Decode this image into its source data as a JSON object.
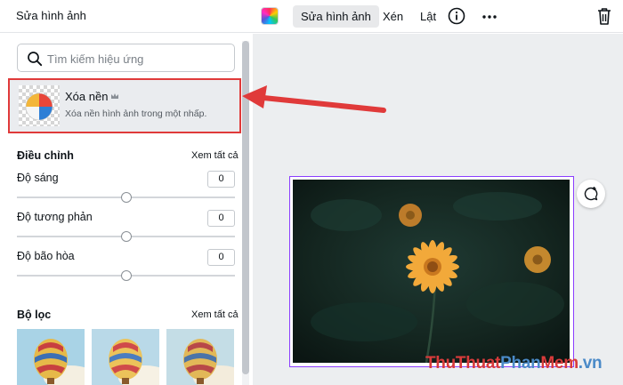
{
  "header": {
    "panel_title": "Sửa hình ảnh",
    "toolbar": [
      {
        "label": "Sửa hình ảnh",
        "active": true
      },
      {
        "label": "Xén",
        "active": false
      },
      {
        "label": "Lật",
        "active": false
      }
    ],
    "icons": [
      "color-picker-icon",
      "info-icon",
      "more-icon",
      "trash-icon"
    ]
  },
  "search": {
    "placeholder": "Tìm kiếm hiệu ứng",
    "value": ""
  },
  "featured_effect": {
    "name": "Xóa nền",
    "description": "Xóa nền hình ảnh trong một nhấp.",
    "badge_icon": "crown-icon",
    "highlight_color": "#e03a3a"
  },
  "adjust": {
    "title": "Điều chỉnh",
    "see_all": "Xem tất cả",
    "sliders": [
      {
        "label": "Độ sáng",
        "value": "0",
        "level": 0
      },
      {
        "label": "Độ tương phản",
        "value": "0",
        "level": 0
      },
      {
        "label": "Độ bão hòa",
        "value": "0",
        "level": 0
      }
    ]
  },
  "filters": {
    "title": "Bộ lọc",
    "see_all": "Xem tất cả",
    "items": [
      "balloon-filter-preview",
      "balloon-filter-preview",
      "balloon-filter-preview"
    ]
  },
  "canvas": {
    "selection_color": "#8b3dff",
    "comment_icon": "add-comment-icon"
  },
  "watermark": {
    "parts": [
      "Thu",
      "Thuat",
      "Phan",
      "Mem",
      ".vn"
    ],
    "colors": [
      "#d93b3b",
      "#d93b3b",
      "#4a8ac8",
      "#d93b3b",
      "#4a8ac8"
    ]
  },
  "colors": {
    "accent": "#8b3dff",
    "annotation_red": "#e03a3a"
  }
}
